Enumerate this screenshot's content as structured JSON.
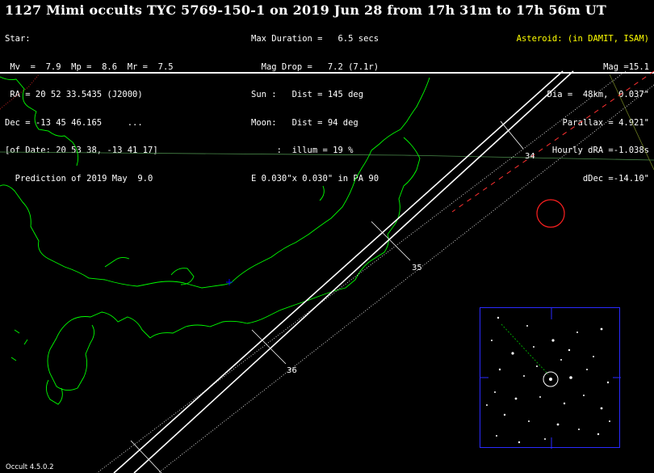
{
  "header": {
    "title": "1127 Mimi occults TYC 5769-150-1 on 2019 Jun 28 from 17h 31m to 17h 56m UT",
    "left_lines": [
      "Star:",
      " Mv  =  7.9  Mp =  8.6  Mr =  7.5",
      " RA = 20 52 33.5435 (J2000)",
      "Dec = -13 45 46.165     ...",
      "[of Date: 20 53 38, -13 41 17]",
      "  Prediction of 2019 May  9.0"
    ],
    "mid_lines": [
      "Max Duration =   6.5 secs",
      "  Mag Drop =   7.2 (7.1r)",
      "Sun :   Dist = 145 deg",
      "Moon:   Dist = 94 deg",
      "     :  illum = 19 %",
      "E 0.030\"x 0.030\" in PA 90"
    ],
    "right_lines": [
      "Asteroid: (in DAMIT, ISAM)",
      "Mag =15.1",
      "Dia =  48km,  0.037\"",
      "Parallax = 4.921\"",
      "Hourly dRA =-1.038s",
      "dDec =-14.10\""
    ],
    "asteroid_label_color": "#ffff00"
  },
  "map": {
    "coastline_color": "#00ff00",
    "path_color": "#ffffff",
    "error_limit_color": "#ff3030",
    "city_marker_color": "#0000ff",
    "time_ticks": [
      "34",
      "35",
      "36"
    ]
  },
  "inset": {
    "border_color": "#2a2aff",
    "target_circle_color": "#ffffff",
    "track_color": "#00a000"
  },
  "footer": {
    "version": "Occult 4.5.0.2"
  }
}
